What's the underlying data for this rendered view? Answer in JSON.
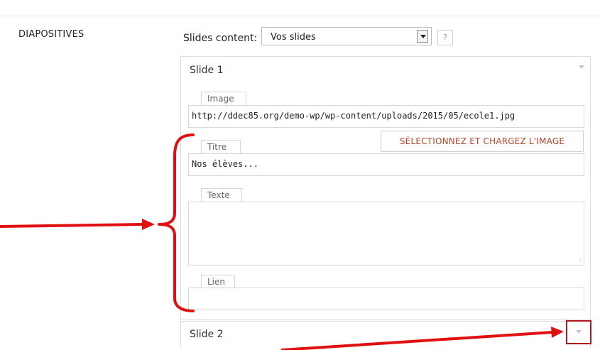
{
  "section": {
    "label": "DIAPOSITIVES"
  },
  "slides_content": {
    "label": "Slides content:",
    "selected": "Vos slides",
    "help": "?"
  },
  "slide1": {
    "title": "Slide 1",
    "image": {
      "label": "Image",
      "value": "http://ddec85.org/demo-wp/wp-content/uploads/2015/05/ecole1.jpg",
      "button": "SÉLECTIONNEZ ET CHARGEZ L'IMAGE"
    },
    "titre": {
      "label": "Titre",
      "value": "Nos élèves..."
    },
    "texte": {
      "label": "Texte",
      "value": ""
    },
    "lien": {
      "label": "Lien",
      "value": ""
    }
  },
  "slide2": {
    "title": "Slide 2"
  },
  "colors": {
    "annotation_red": "#e10f0f",
    "highlight_red": "#b11717",
    "button_text": "#b1472b"
  }
}
